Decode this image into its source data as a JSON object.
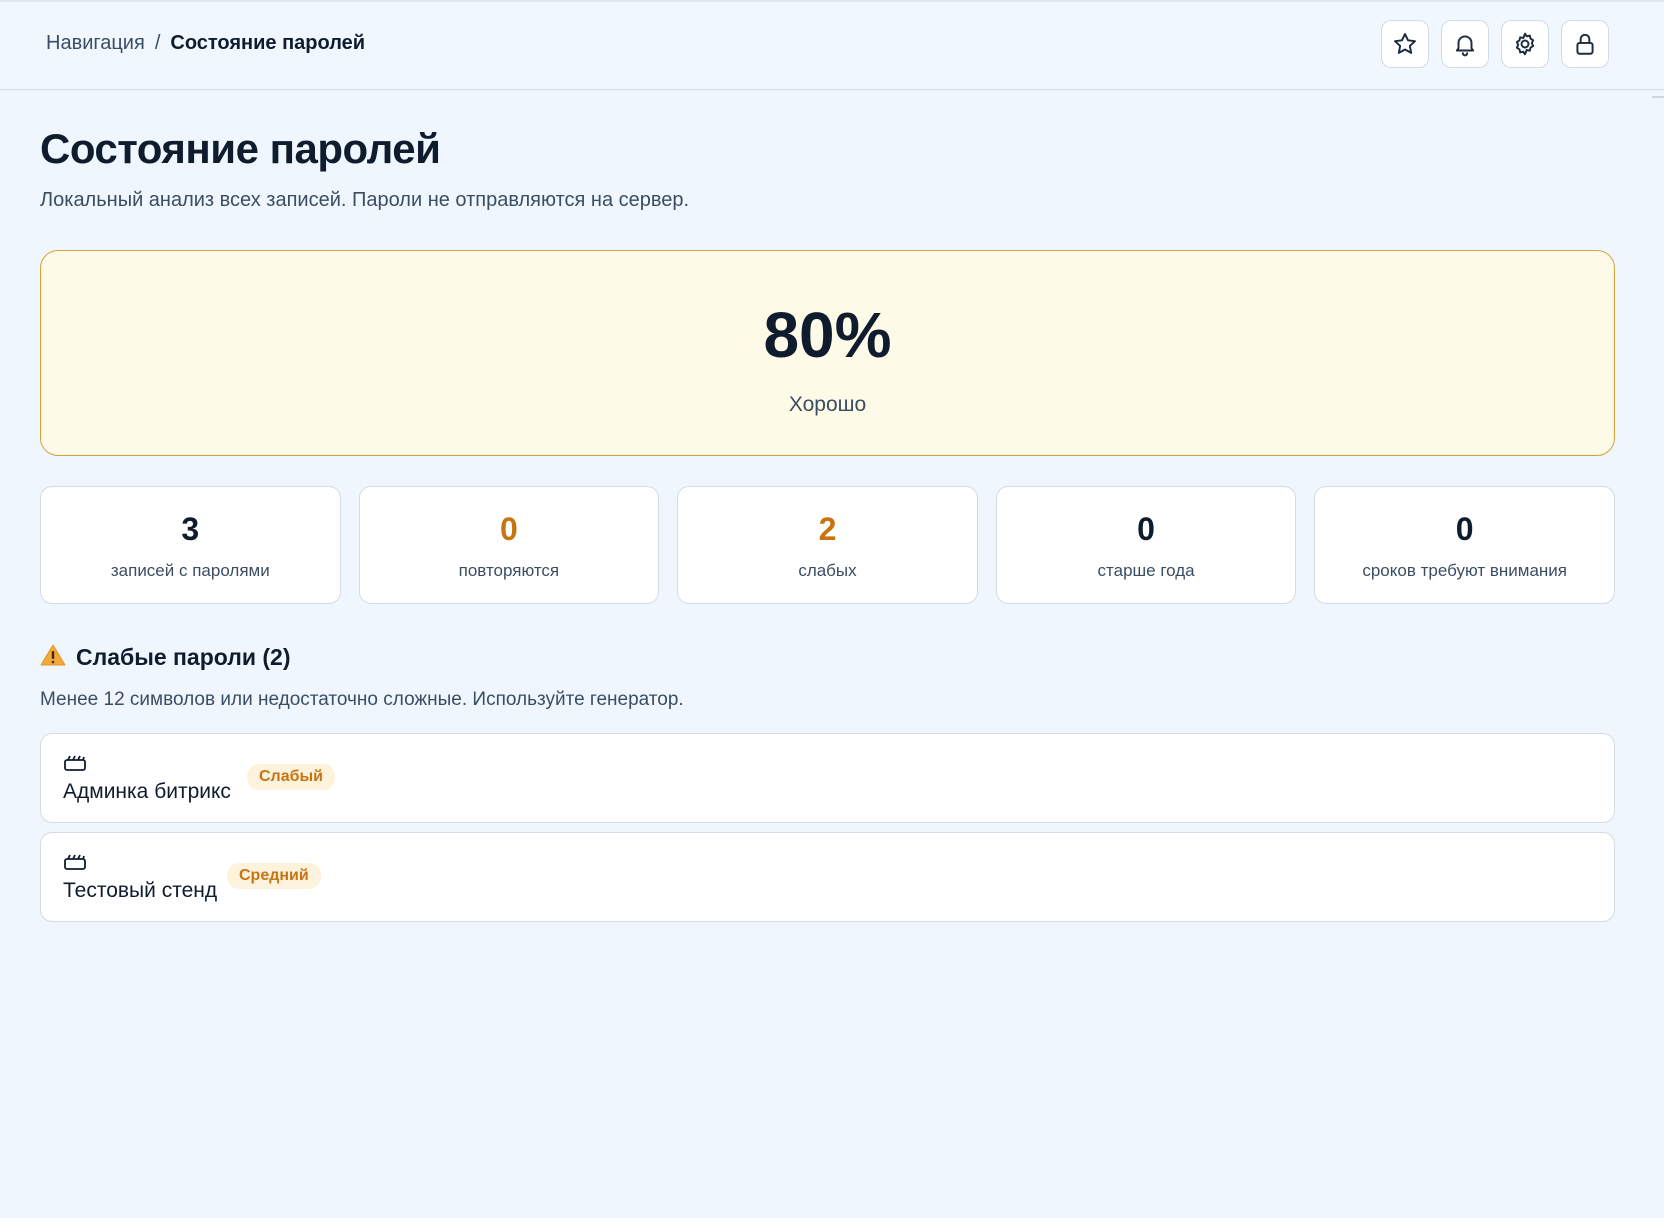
{
  "header": {
    "breadcrumb": {
      "root": "Навигация",
      "separator": "/",
      "current": "Состояние паролей"
    },
    "actions": [
      {
        "icon": "star-icon"
      },
      {
        "icon": "bell-icon"
      },
      {
        "icon": "gear-icon"
      },
      {
        "icon": "lock-icon"
      }
    ]
  },
  "page": {
    "title": "Состояние паролей",
    "subtitle": "Локальный анализ всех записей. Пароли не отправляются на сервер."
  },
  "score": {
    "value": "80%",
    "label": "Хорошо"
  },
  "stats": [
    {
      "value": "3",
      "label": "записей с паролями",
      "color": "#0f1c2e"
    },
    {
      "value": "0",
      "label": "повторяются",
      "color": "#c97412"
    },
    {
      "value": "2",
      "label": "слабых",
      "color": "#c97412"
    },
    {
      "value": "0",
      "label": "старше года",
      "color": "#0f1c2e"
    },
    {
      "value": "0",
      "label": "сроков требуют внимания",
      "color": "#0f1c2e"
    }
  ],
  "weak_section": {
    "icon": "warning-icon",
    "title": "Слабые пароли (2)",
    "description": "Менее 12 символов или недостаточно сложные. Используйте генератор."
  },
  "weak_entries": [
    {
      "icon": "server-icon",
      "name": "Админка битрикс",
      "badge": "Слабый"
    },
    {
      "icon": "server-icon",
      "name": "Тестовый стенд",
      "badge": "Средний"
    }
  ],
  "colors": {
    "background": "#eff6fe",
    "score_card_bg": "#fefae8",
    "score_card_border": "#d7a03a",
    "warning_accent": "#c97412",
    "badge_bg": "#fdf3dc"
  }
}
